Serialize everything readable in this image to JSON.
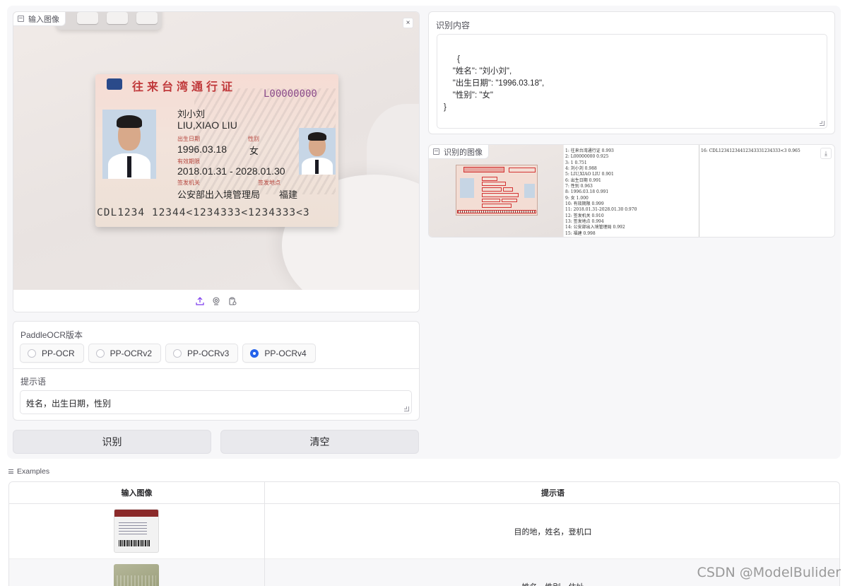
{
  "input_panel": {
    "label": "输入图像",
    "close_glyph": "×",
    "card": {
      "title": "往来台湾通行证",
      "number": "L00000000",
      "name_cn": "刘小刘",
      "name_pinyin": "LIU,XIAO LIU",
      "dob_label": "出生日期",
      "dob": "1996.03.18",
      "sex_label": "性别",
      "sex": "女",
      "validity_label": "有效期限",
      "validity": "2018.01.31 - 2028.01.30",
      "authority_label": "签发机关",
      "authority": "公安部出入境管理局",
      "place_label": "签发地点",
      "place": "福建",
      "mrz": "CDL1234 12344<1234333<1234333<3"
    },
    "source_icons": [
      "upload-icon",
      "webcam-icon",
      "clipboard-icon"
    ]
  },
  "version_panel": {
    "label": "PaddleOCR版本",
    "options": [
      {
        "label": "PP-OCR",
        "selected": false
      },
      {
        "label": "PP-OCRv2",
        "selected": false
      },
      {
        "label": "PP-OCRv3",
        "selected": false
      },
      {
        "label": "PP-OCRv4",
        "selected": true
      }
    ],
    "prompt_label": "提示语",
    "prompt_value": "姓名，出生日期，性别"
  },
  "buttons": {
    "recognize": "识别",
    "clear": "清空"
  },
  "result_panel": {
    "label": "识别内容",
    "text": "{\n    \"姓名\": \"刘小刘\",\n    \"出生日期\": \"1996.03.18\",\n    \"性别\": \"女\"\n}"
  },
  "result_image_panel": {
    "label": "识别的图像",
    "download_glyph": "⤓",
    "lines_left": [
      "1:  往来台湾通行证    0.993",
      "2:  L00000000    0.925",
      "3:  1    0.751",
      "4:  刘小刘    0.988",
      "5:  LIU,XIAO LIU    0.901",
      "6:  出生日期    0.991",
      "7:  性别    0.963",
      "8:  1996.03.18    0.991",
      "9:  女    1.000",
      "10:  有效期限    0.999",
      "11:  2018.01.31-2028.01.30    0.970",
      "12:  签发机关    0.910",
      "13:  签发地点    0.994",
      "14:  公安部出入境管理局    0.992",
      "15:  福建    0.998"
    ],
    "lines_right": [
      "16:  CDL12341234412343331234333<3    0.965"
    ]
  },
  "examples": {
    "label": "Examples",
    "columns": [
      "输入图像",
      "提示语"
    ],
    "rows": [
      {
        "prompt": "目的地，姓名，登机口"
      },
      {
        "prompt": "姓名，性别，住址"
      }
    ]
  },
  "watermark": "CSDN @ModelBulider",
  "colors": {
    "accent": "#2563eb",
    "upload_accent": "#7c3aed",
    "page_bg": "#f7f7f9",
    "panel_border": "#e4e4e7"
  }
}
